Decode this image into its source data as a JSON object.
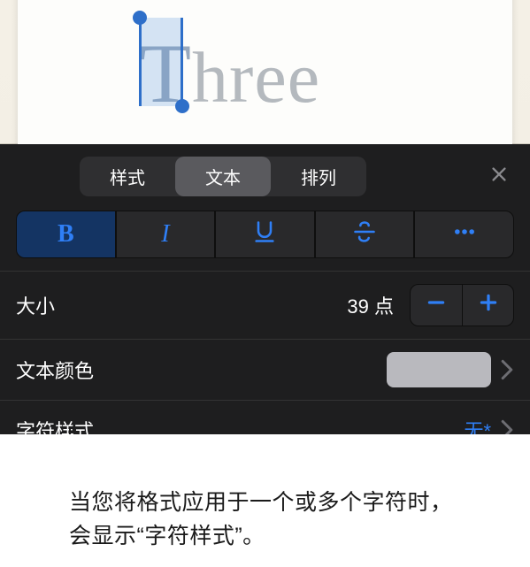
{
  "canvas": {
    "sample_text_first": "T",
    "sample_text_rest": "hree"
  },
  "tabs": {
    "style": "样式",
    "text": "文本",
    "arrange": "排列"
  },
  "style_buttons": {
    "bold": "B",
    "italic": "I"
  },
  "rows": {
    "size_label": "大小",
    "size_value": "39 点",
    "color_label": "文本颜色",
    "char_style_label": "字符样式",
    "char_style_value": "无*"
  },
  "caption": {
    "line1": "当您将格式应用于一个或多个字符时，",
    "line2": "会显示“字符样式”。"
  },
  "colors": {
    "accent": "#2f7ff6",
    "swatch": "#b9b9be"
  }
}
